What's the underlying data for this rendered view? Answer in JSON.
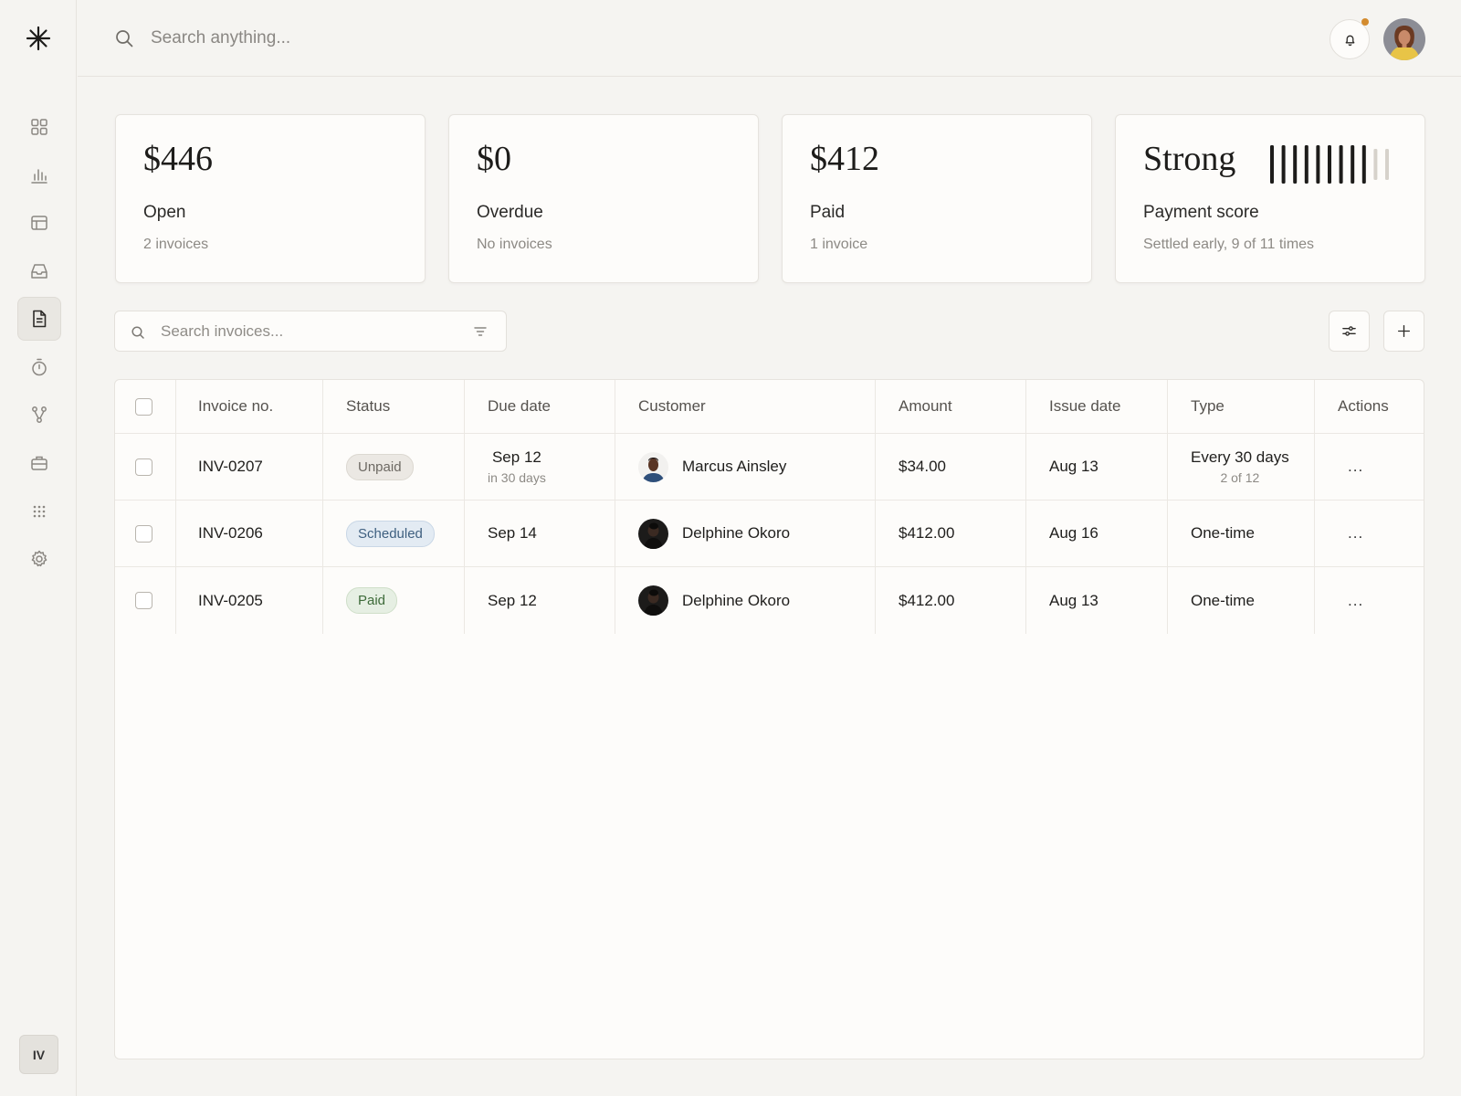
{
  "topbar": {
    "search_placeholder": "Search anything..."
  },
  "sidebar": {
    "items": [
      {
        "name": "grid-icon"
      },
      {
        "name": "bar-chart-icon"
      },
      {
        "name": "layout-icon"
      },
      {
        "name": "inbox-icon"
      },
      {
        "name": "document-icon",
        "active": true
      },
      {
        "name": "timer-icon"
      },
      {
        "name": "branch-icon"
      },
      {
        "name": "briefcase-icon"
      },
      {
        "name": "apps-grid-icon"
      },
      {
        "name": "gear-icon"
      }
    ],
    "workspace_initials": "IV"
  },
  "cards": [
    {
      "value": "$446",
      "label": "Open",
      "sub": "2 invoices"
    },
    {
      "value": "$0",
      "label": "Overdue",
      "sub": "No invoices"
    },
    {
      "value": "$412",
      "label": "Paid",
      "sub": "1 invoice"
    },
    {
      "value": "Strong",
      "label": "Payment score",
      "sub": "Settled early, 9 of 11 times",
      "score_filled": 9,
      "score_total": 11
    }
  ],
  "invoices_toolbar": {
    "search_placeholder": "Search invoices..."
  },
  "table": {
    "headers": {
      "invoice_no": "Invoice no.",
      "status": "Status",
      "due_date": "Due date",
      "customer": "Customer",
      "amount": "Amount",
      "issue_date": "Issue date",
      "type": "Type",
      "actions": "Actions"
    },
    "rows": [
      {
        "invoice_no": "INV-0207",
        "status": "Unpaid",
        "due_date": "Sep 12",
        "due_sub": "in 30 days",
        "customer": "Marcus Ainsley",
        "amount": "$34.00",
        "issue_date": "Aug 13",
        "type": "Every 30 days",
        "type_sub": "2 of 12",
        "actions": "..."
      },
      {
        "invoice_no": "INV-0206",
        "status": "Scheduled",
        "due_date": "Sep 14",
        "customer": "Delphine Okoro",
        "amount": "$412.00",
        "issue_date": "Aug 16",
        "type": "One-time",
        "actions": "..."
      },
      {
        "invoice_no": "INV-0205",
        "status": "Paid",
        "due_date": "Sep 12",
        "customer": "Delphine Okoro",
        "amount": "$412.00",
        "issue_date": "Aug 13",
        "type": "One-time",
        "actions": "..."
      }
    ]
  },
  "colors": {
    "background": "#f5f4f1",
    "card": "#fdfcfa",
    "notification_dot": "#d38b2e",
    "badge_unpaid": "#ebe8e3",
    "badge_scheduled": "#e3ebf3",
    "badge_paid": "#e6efe3"
  }
}
